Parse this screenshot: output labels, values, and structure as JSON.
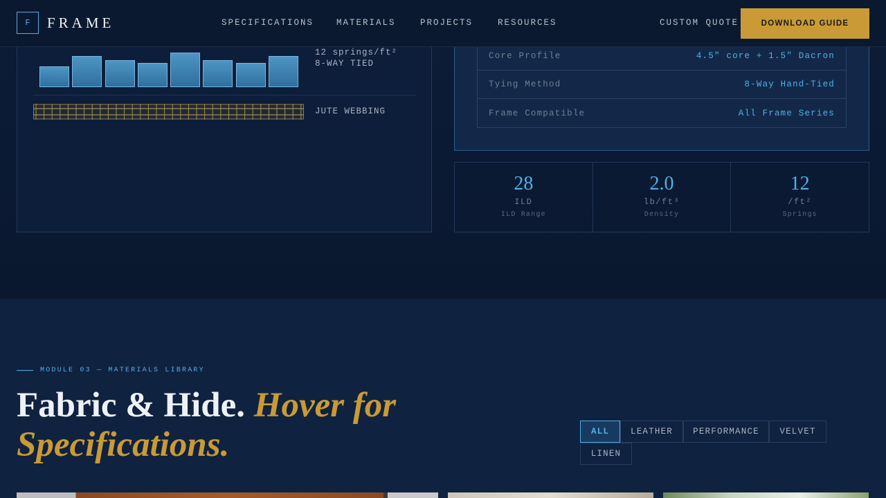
{
  "header": {
    "logo_mark": "F",
    "logo_text": "FRAME",
    "nav": [
      "SPECIFICATIONS",
      "MATERIALS",
      "PROJECTS",
      "RESOURCES"
    ],
    "custom_quote": "CUSTOM QUOTE",
    "cta": "DOWNLOAD GUIDE"
  },
  "construction": {
    "springs_line1": "12 springs/ft²",
    "springs_line2": "8-WAY TIED",
    "webbing_label": "JUTE WEBBING",
    "spring_levels": [
      0.53,
      0.8,
      0.7,
      0.62,
      0.9,
      0.7,
      0.62,
      0.8
    ]
  },
  "specs": [
    {
      "key": "Core Profile",
      "value": "4.5\" core + 1.5\" Dacron"
    },
    {
      "key": "Tying Method",
      "value": "8-Way Hand-Tied"
    },
    {
      "key": "Frame Compatible",
      "value": "All Frame Series"
    }
  ],
  "stats": [
    {
      "value": "28",
      "unit": "ILD",
      "label": "ILD Range"
    },
    {
      "value": "2.0",
      "unit": "lb/ft³",
      "label": "Density"
    },
    {
      "value": "12",
      "unit": "/ft²",
      "label": "Springs"
    }
  ],
  "materials": {
    "eyebrow": "MODULE 03 — MATERIALS LIBRARY",
    "title_plain": "Fabric & Hide.",
    "title_accent": "Hover for Specifications.",
    "filters": [
      "ALL",
      "LEATHER",
      "PERFORMANCE",
      "VELVET",
      "LINEN"
    ],
    "active_filter": "ALL"
  },
  "colors": {
    "accent_blue": "#4fb1e6",
    "accent_gold": "#c99a35",
    "background": "#0c1a33"
  }
}
